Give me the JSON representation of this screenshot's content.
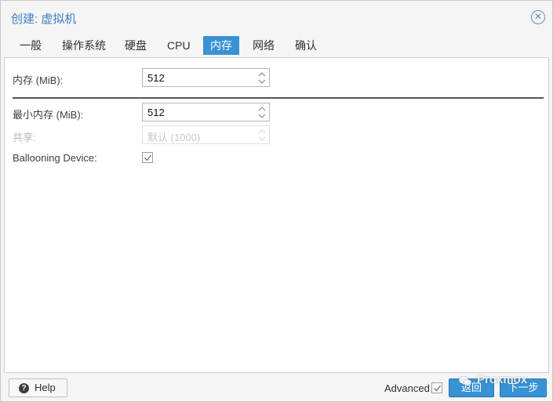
{
  "dialog": {
    "title": "创建: 虚拟机",
    "close_icon": "close-icon"
  },
  "tabs": [
    {
      "label": "一般",
      "active": false
    },
    {
      "label": "操作系统",
      "active": false
    },
    {
      "label": "硬盘",
      "active": false
    },
    {
      "label": "CPU",
      "active": false
    },
    {
      "label": "内存",
      "active": true
    },
    {
      "label": "网络",
      "active": false
    },
    {
      "label": "确认",
      "active": false
    }
  ],
  "form": {
    "memory": {
      "label": "内存 (MiB):",
      "value": "512"
    },
    "min_memory": {
      "label": "最小内存 (MiB):",
      "value": "512"
    },
    "shares": {
      "label": "共享:",
      "placeholder": "默认 (1000)",
      "disabled": true
    },
    "ballooning": {
      "label": "Ballooning Device:",
      "checked": true
    }
  },
  "footer": {
    "help_label": "Help",
    "advanced_label": "Advanced",
    "advanced_checked": true,
    "back_label": "返回",
    "next_label": "下一步"
  },
  "watermark": {
    "text": "Proxmox"
  },
  "colors": {
    "accent": "#3892d4",
    "title": "#3d7fc4",
    "disabled_text": "#b8b8b8"
  }
}
